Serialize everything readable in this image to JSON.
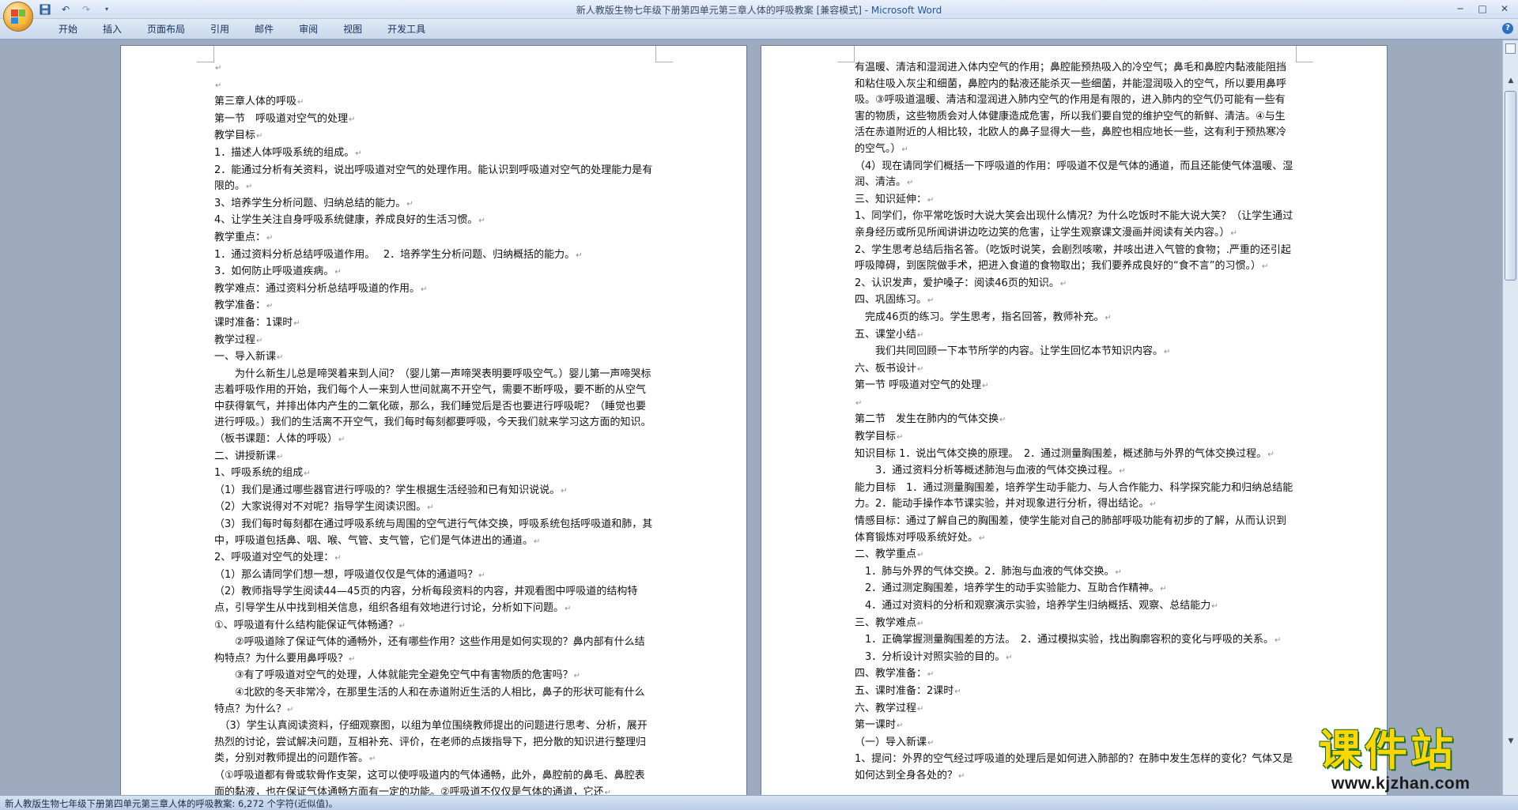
{
  "window": {
    "title": "新人教版生物七年级下册第四单元第三章人体的呼吸教案 [兼容模式] - ",
    "app_name": "Microsoft Word"
  },
  "ribbon": {
    "tabs": [
      "开始",
      "插入",
      "页面布局",
      "引用",
      "邮件",
      "审阅",
      "视图",
      "开发工具"
    ]
  },
  "page1": {
    "paragraphs": [
      "",
      "",
      "第三章人体的呼吸",
      "第一节　呼吸道对空气的处理",
      "教学目标",
      "1．描述人体呼吸系统的组成。",
      "2．能通过分析有关资料，说出呼吸道对空气的处理作用。能认识到呼吸道对空气的处理能力是有限的。",
      "3、培养学生分析问题、归纳总结的能力。",
      "4、让学生关注自身呼吸系统健康，养成良好的生活习惯。",
      "教学重点：",
      "1．通过资料分析总结呼吸道作用。　 2．培养学生分析问题、归纳概括的能力。",
      "3．如何防止呼吸道疾病。",
      "教学难点：通过资料分析总结呼吸道的作用。",
      "教学准备：",
      "课时准备：1课时",
      "教学过程",
      "一、导入新课",
      "　　为什么新生儿总是啼哭着来到人间？（婴儿第一声啼哭表明要呼吸空气。）婴儿第一声啼哭标志着呼吸作用的开始，我们每个人一来到人世间就离不开空气，需要不断呼吸，要不断的从空气中获得氧气，并排出体内产生的二氧化碳，那么，我们睡觉后是否也要进行呼吸呢？（睡觉也要进行呼吸。）我们的生活离不开空气，我们每时每刻都要呼吸，今天我们就来学习这方面的知识。（板书课题：人体的呼吸）",
      "二、讲授新课",
      "1、呼吸系统的组成",
      "（1）我们是通过哪些器官进行呼吸的？学生根据生活经验和已有知识说说。",
      "（2）大家说得对不对呢？指导学生阅读识图。",
      "（3）我们每时每刻都在通过呼吸系统与周围的空气进行气体交换，呼吸系统包括呼吸道和肺，其中，呼吸道包括鼻、咽、喉、气管、支气管，它们是气体进出的通道。",
      "2、呼吸道对空气的处理：",
      "（1）那么请同学们想一想，呼吸道仅仅是气体的通道吗？",
      "（2）教师指导学生阅读44—45页的内容，分析每段资料的内容，并观看图中呼吸道的结构特点，引导学生从中找到相关信息，组织各组有效地进行讨论，分析如下问题。",
      "①、呼吸道有什么结构能保证气体畅通？",
      "　　②呼吸道除了保证气体的通畅外，还有哪些作用？这些作用是如何实现的？鼻内部有什么结构特点？为什么要用鼻呼吸？",
      "　　③有了呼吸道对空气的处理，人体就能完全避免空气中有害物质的危害吗？",
      "　　④北欧的冬天非常冷，在那里生活的人和在赤道附近生活的人相比，鼻子的形状可能有什么特点？为什么？",
      "　（3）学生认真阅读资料，仔细观察图，以组为单位围绕教师提出的问题进行思考、分析，展开热烈的讨论，尝试解决问题，互相补充、评价，在老师的点拨指导下，把分散的知识进行整理归类，分别对教师提出的问题作答。",
      "（①呼吸道都有骨或软骨作支架，这可以使呼吸道内的气体通畅，此外，鼻腔前的鼻毛、鼻腔表面的黏液，也在保证气体通畅方面有一定的功能。②呼吸道不仅仅是气体的通道，它还"
    ]
  },
  "page2": {
    "paragraphs": [
      "有温暖、清洁和湿润进入体内空气的作用；鼻腔能预热吸入的冷空气；鼻毛和鼻腔内黏液能阻挡和粘住吸入灰尘和细菌，鼻腔内的黏液还能杀灭一些细菌，并能湿润吸入的空气，所以要用鼻呼吸。③呼吸道温暖、清洁和湿润进入肺内空气的作用是有限的，进入肺内的空气仍可能有一些有害的物质，这些物质会对人体健康造成危害，所以我们要自觉的维护空气的新鲜、清洁。④与生活在赤道附近的人相比较，北欧人的鼻子显得大一些，鼻腔也相应地长一些，这有利于预热寒冷的空气。）",
      "（4）现在请同学们概括一下呼吸道的作用：呼吸道不仅是气体的通道，而且还能使气体温暖、湿润、清洁。",
      "三、知识延伸：",
      "1、同学们，你平常吃饭时大说大笑会出现什么情况？为什么吃饭时不能大说大笑？（让学生通过亲身经历或所见所闻讲讲边吃边笑的危害，让学生观察课文漫画并阅读有关内容。）",
      "2、学生思考总结后指名答。（吃饭时说笑，会剧烈咳嗽，并咳出进入气管的食物；.严重的还引起呼吸障碍，到医院做手术，把进入食道的食物取出；我们要养成良好的“食不言”的习惯。）",
      "2、认识发声，爱护嗓子：阅读46页的知识。",
      "四、巩固练习。",
      "　完成46页的练习。学生思考，指名回答，教师补充。",
      "五、课堂小结",
      "　　我们共同回顾一下本节所学的内容。让学生回忆本节知识内容。",
      "六、板书设计",
      "第一节 呼吸道对空气的处理",
      "",
      "第二节　发生在肺内的气体交换",
      "教学目标",
      "知识目标 1．说出气体交换的原理。　2．通过测量胸围差，概述肺与外界的气体交换过程。",
      "　　3．通过资料分析等概述肺泡与血液的气体交换过程。",
      "能力目标　1．通过测量胸围差，培养学生动手能力、与人合作能力、科学探究能力和归纳总结能力。2．能动手操作本节课实验，并对现象进行分析，得出结论。",
      "情感目标：通过了解自己的胸围差，使学生能对自己的肺部呼吸功能有初步的了解，从而认识到体育锻炼对呼吸系统好处。",
      "二、教学重点",
      "　1．肺与外界的气体交换。2．肺泡与血液的气体交换。",
      "　2．通过测定胸围差，培养学生的动手实验能力、互助合作精神。",
      "　4．通过对资料的分析和观察演示实验，培养学生归纳概括、观察、总结能力",
      "三、教学难点",
      "　1．正确掌握测量胸围差的方法。　2．通过模拟实验，找出胸廓容积的变化与呼吸的关系。",
      "　3．分析设计对照实验的目的。",
      "四、教学准备：",
      "五、课时准备：2课时",
      "六、教学过程",
      "第一课时",
      "（一）导入新课",
      "1、提问：外界的空气经过呼吸道的处理后是如何进入肺部的？在肺中发生怎样的变化？气体又是如何达到全身各处的？"
    ]
  },
  "statusbar": {
    "text": "新人教版生物七年级下册第四单元第三章人体的呼吸教案: 6,272 个字符(近似值)。"
  },
  "watermark": {
    "title": "课件站",
    "url": "www.kjzhan.com"
  },
  "icons": [
    "office-button",
    "save-icon",
    "undo-icon",
    "redo-icon",
    "customize-qat-icon",
    "minimize-icon",
    "maximize-icon",
    "close-icon",
    "help-icon",
    "view-ruler-icon",
    "scroll-up-icon",
    "scroll-down-icon"
  ]
}
